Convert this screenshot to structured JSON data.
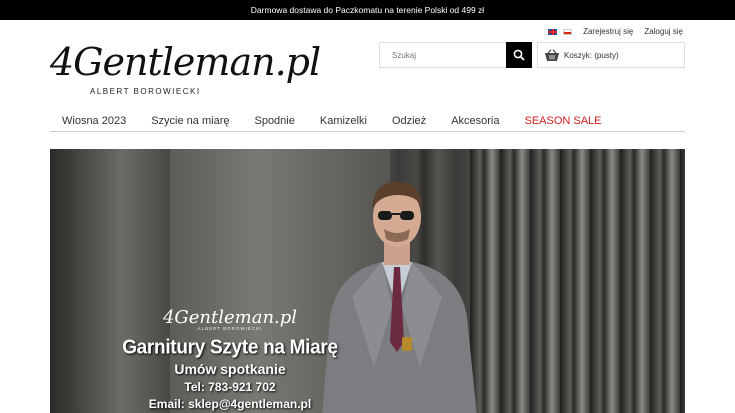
{
  "topbar": {
    "text": "Darmowa dostawa do Paczkomatu na terenie Polski od 499 zł"
  },
  "header": {
    "register_label": "Zarejestruj się",
    "login_label": "Zaloguj się",
    "logo_text": "4Gentleman.pl",
    "logo_subtitle": "ALBERT BOROWIECKI",
    "search_placeholder": "Szukaj",
    "cart_label": "Koszyk: (pusty)"
  },
  "nav": {
    "items": [
      {
        "label": "Wiosna 2023"
      },
      {
        "label": "Szycie na miarę"
      },
      {
        "label": "Spodnie"
      },
      {
        "label": "Kamizelki"
      },
      {
        "label": "Odzież"
      },
      {
        "label": "Akcesoria"
      },
      {
        "label": "SEASON SALE"
      }
    ]
  },
  "hero": {
    "logo_text": "4Gentleman.pl",
    "logo_subtitle": "ALBERT BOROWIECKI",
    "headline": "Garnitury Szyte na Miarę",
    "subheadline": "Umów spotkanie",
    "phone": "Tel: 783-921 702",
    "email": "Email: sklep@4gentleman.pl"
  },
  "colors": {
    "sale": "#d42020",
    "topbar_bg": "#000000"
  }
}
